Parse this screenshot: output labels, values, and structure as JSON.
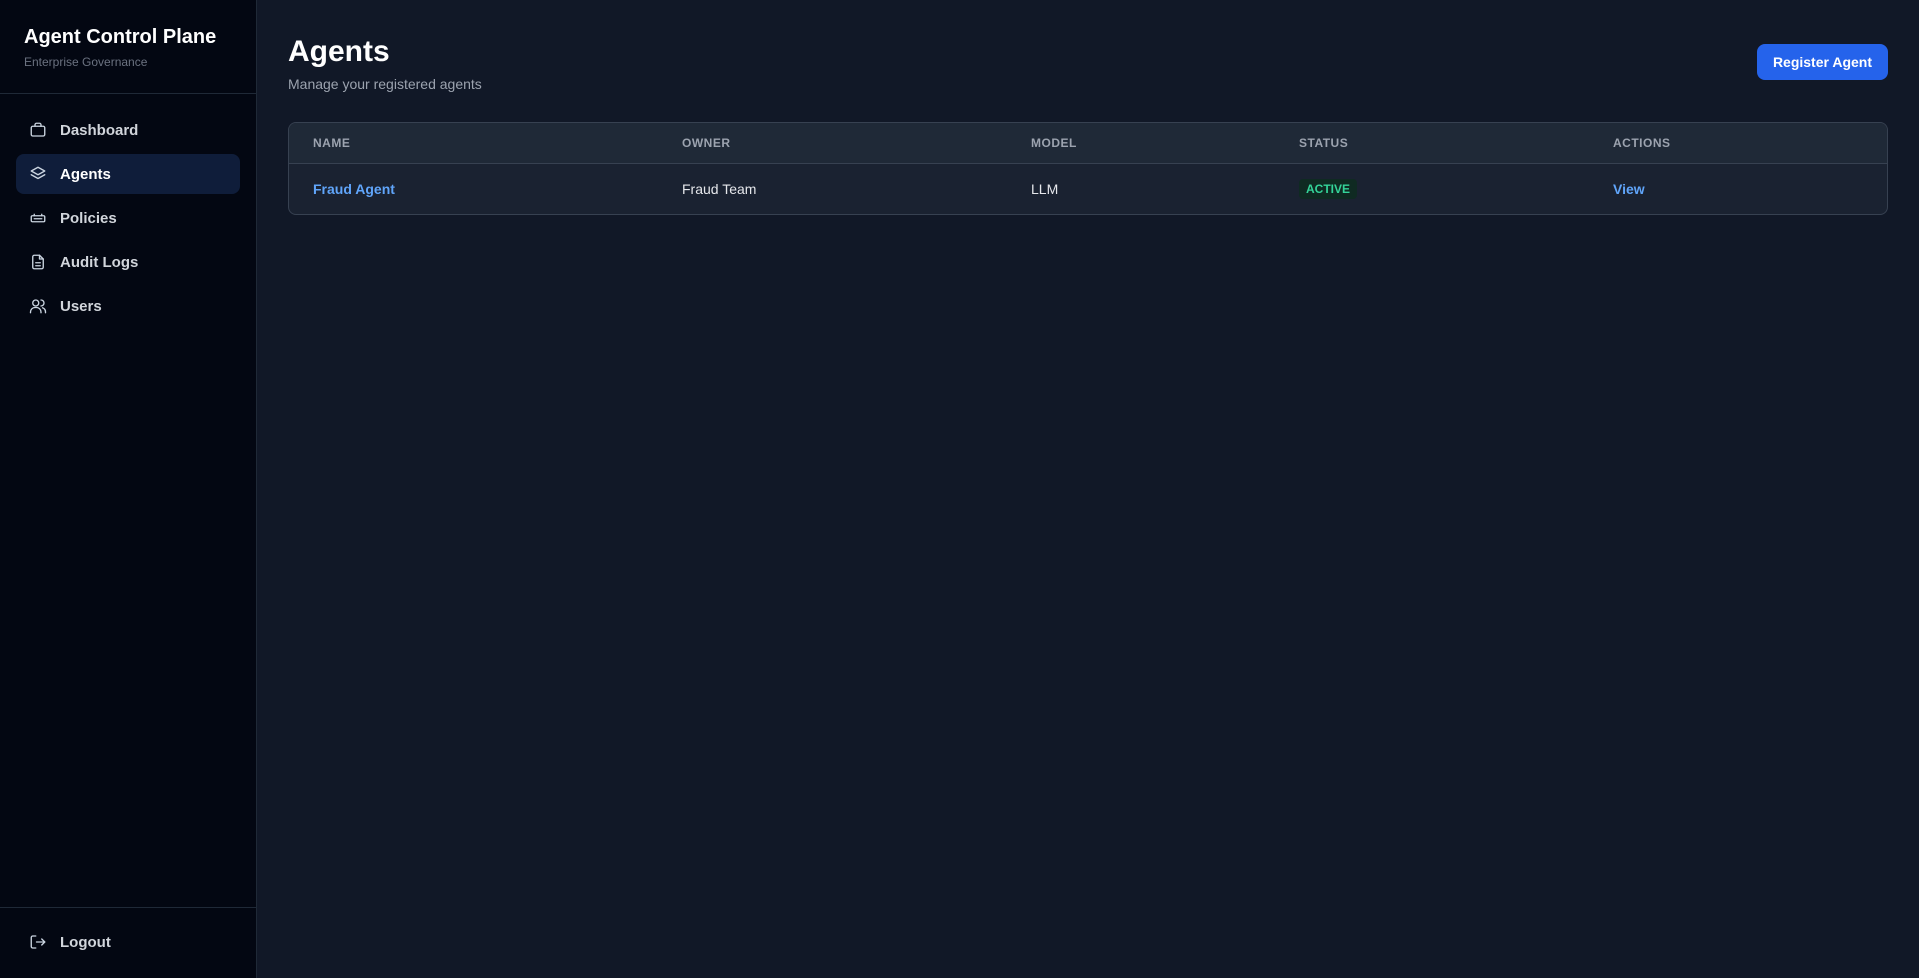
{
  "sidebar": {
    "title": "Agent Control Plane",
    "subtitle": "Enterprise Governance",
    "items": [
      {
        "label": "Dashboard",
        "icon": "briefcase-icon",
        "active": false
      },
      {
        "label": "Agents",
        "icon": "layers-icon",
        "active": true
      },
      {
        "label": "Policies",
        "icon": "policy-icon",
        "active": false
      },
      {
        "label": "Audit Logs",
        "icon": "document-icon",
        "active": false
      },
      {
        "label": "Users",
        "icon": "users-icon",
        "active": false
      }
    ],
    "logout_label": "Logout"
  },
  "main": {
    "title": "Agents",
    "subtitle": "Manage your registered agents",
    "register_button": "Register Agent",
    "table": {
      "columns": [
        "NAME",
        "OWNER",
        "MODEL",
        "STATUS",
        "ACTIONS"
      ],
      "rows": [
        {
          "name": "Fraud Agent",
          "owner": "Fraud Team",
          "model": "LLM",
          "status": "ACTIVE",
          "action": "View"
        }
      ]
    }
  },
  "colors": {
    "accent": "#2563eb",
    "link": "#60a5fa",
    "status_active": "#34d399",
    "sidebar_bg": "#030712",
    "main_bg": "#111827"
  }
}
